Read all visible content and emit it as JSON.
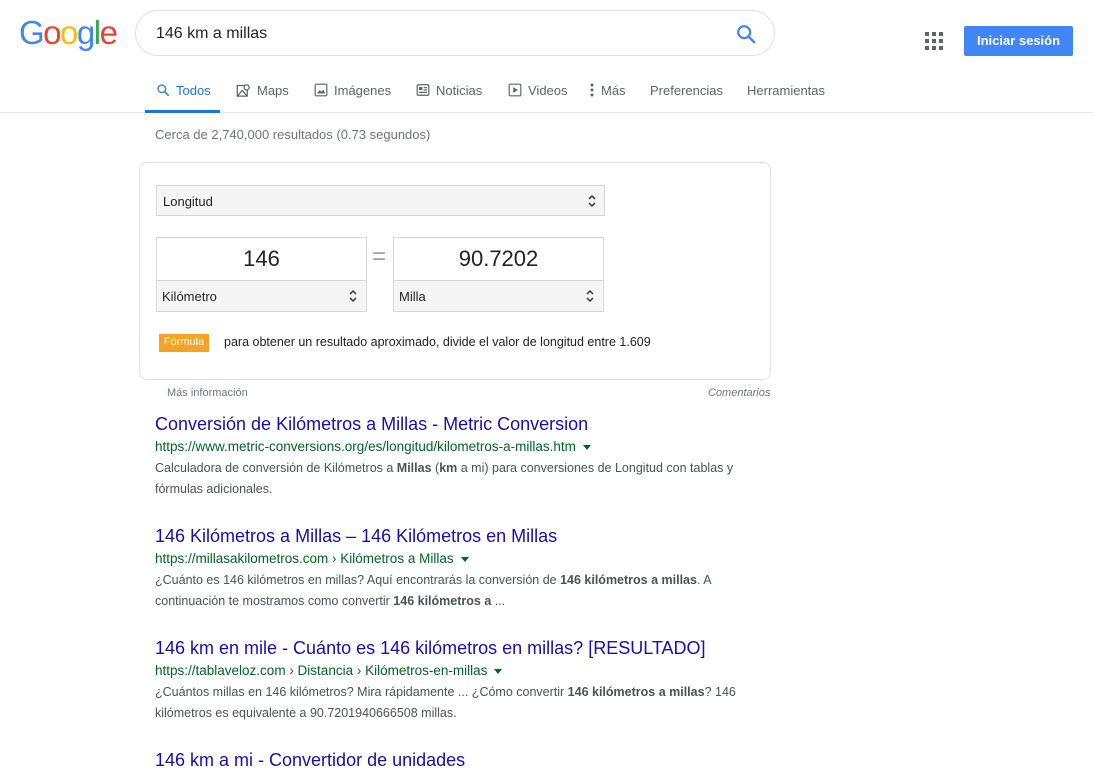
{
  "header": {
    "logo_text": "Google",
    "logo_letters": [
      {
        "ch": "G",
        "color": "#4285F4"
      },
      {
        "ch": "o",
        "color": "#EA4335"
      },
      {
        "ch": "o",
        "color": "#FBBC05"
      },
      {
        "ch": "g",
        "color": "#4285F4"
      },
      {
        "ch": "l",
        "color": "#34A853"
      },
      {
        "ch": "e",
        "color": "#EA4335"
      }
    ],
    "query": "146 km a millas",
    "signin_label": "Iniciar sesión",
    "signin_color": "#4285f4"
  },
  "tabs": [
    {
      "label": "Todos",
      "icon": "search-icon",
      "active": true
    },
    {
      "label": "Maps",
      "icon": "map-icon"
    },
    {
      "label": "Imágenes",
      "icon": "image-icon"
    },
    {
      "label": "Noticias",
      "icon": "news-icon"
    },
    {
      "label": "Videos",
      "icon": "video-icon"
    },
    {
      "label": "Más",
      "icon": "more-icon"
    },
    {
      "label": "Preferencias"
    },
    {
      "label": "Herramientas"
    }
  ],
  "stats": "Cerca de 2,740,000 resultados (0.73 segundos)",
  "converter": {
    "category": "Longitud",
    "from_value": "146",
    "from_unit": "Kilómetro",
    "equals": "=",
    "to_value": "90.7202",
    "to_unit": "Milla",
    "formula_label": "Fórmula",
    "formula_text": "para obtener un resultado aproximado, divide el valor de longitud entre 1.609",
    "more_info": "Más información",
    "feedback": "Comentarios"
  },
  "results": [
    {
      "title": "Conversión de Kilómetros a Millas - Metric Conversion",
      "url": "https://www.metric-conversions.org/es/longitud/kilometros-a-millas.htm",
      "snippet_parts": [
        {
          "t": "Calculadora de conversión de Kilómetros a "
        },
        {
          "t": "Millas",
          "b": true
        },
        {
          "t": " ("
        },
        {
          "t": "km",
          "b": true
        },
        {
          "t": " a mi) para conversiones de Longitud con tablas y fórmulas adicionales."
        }
      ]
    },
    {
      "title": "146 Kilómetros a Millas – 146 Kilómetros en Millas",
      "url": "https://millasakilometros.com › Kilómetros a Millas",
      "snippet_parts": [
        {
          "t": "¿Cuánto es 146 kilómetros en millas? Aquí encontrarás la conversión de "
        },
        {
          "t": "146 kilómetros a millas",
          "b": true
        },
        {
          "t": ". A continuación te mostramos como convertir "
        },
        {
          "t": "146 kilómetros a",
          "b": true
        },
        {
          "t": "  ..."
        }
      ]
    },
    {
      "title": "146 km en mile - Cuánto es 146 kilómetros en millas? [RESULTADO]",
      "url": "https://tablaveloz.com › Distancia › Kilómetros-en-millas",
      "snippet_parts": [
        {
          "t": "¿Cuántos millas en 146 kilómetros? Mira rápidamente ... ¿Cómo convertir "
        },
        {
          "t": "146 kilómetros a millas",
          "b": true
        },
        {
          "t": "? 146 kilómetros es equivalente a 90.7201940666508 millas."
        }
      ]
    },
    {
      "title": "146 km a mi - Convertidor de unidades",
      "url": "",
      "snippet_parts": []
    }
  ]
}
